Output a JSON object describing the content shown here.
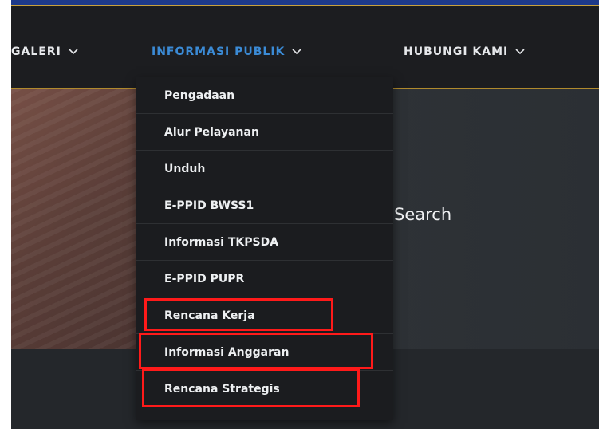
{
  "nav": {
    "items": [
      {
        "label": "GALERI",
        "active": false
      },
      {
        "label": "INFORMASI PUBLIK",
        "active": true
      },
      {
        "label": "HUBUNGI KAMI",
        "active": false
      }
    ]
  },
  "dropdown": {
    "items": [
      {
        "label": "Pengadaan",
        "highlighted": false
      },
      {
        "label": "Alur Pelayanan",
        "highlighted": false
      },
      {
        "label": "Unduh",
        "highlighted": false
      },
      {
        "label": "E-PPID BWSS1",
        "highlighted": false
      },
      {
        "label": "Informasi TKPSDA",
        "highlighted": false
      },
      {
        "label": "E-PPID PUPR",
        "highlighted": false
      },
      {
        "label": "Rencana Kerja",
        "highlighted": true
      },
      {
        "label": "Informasi Anggaran",
        "highlighted": true
      },
      {
        "label": "Rencana Strategis",
        "highlighted": true
      }
    ]
  },
  "hero": {
    "search_label": "Search"
  },
  "colors": {
    "nav_active": "#3b8bd6",
    "nav_text": "#e6e8eb",
    "accent_gold": "#c9a13b",
    "top_strip": "#1e3a8a",
    "highlight_red": "#ff1a1a"
  },
  "icons": {
    "nav_dropdown": "chevron-down-icon"
  }
}
